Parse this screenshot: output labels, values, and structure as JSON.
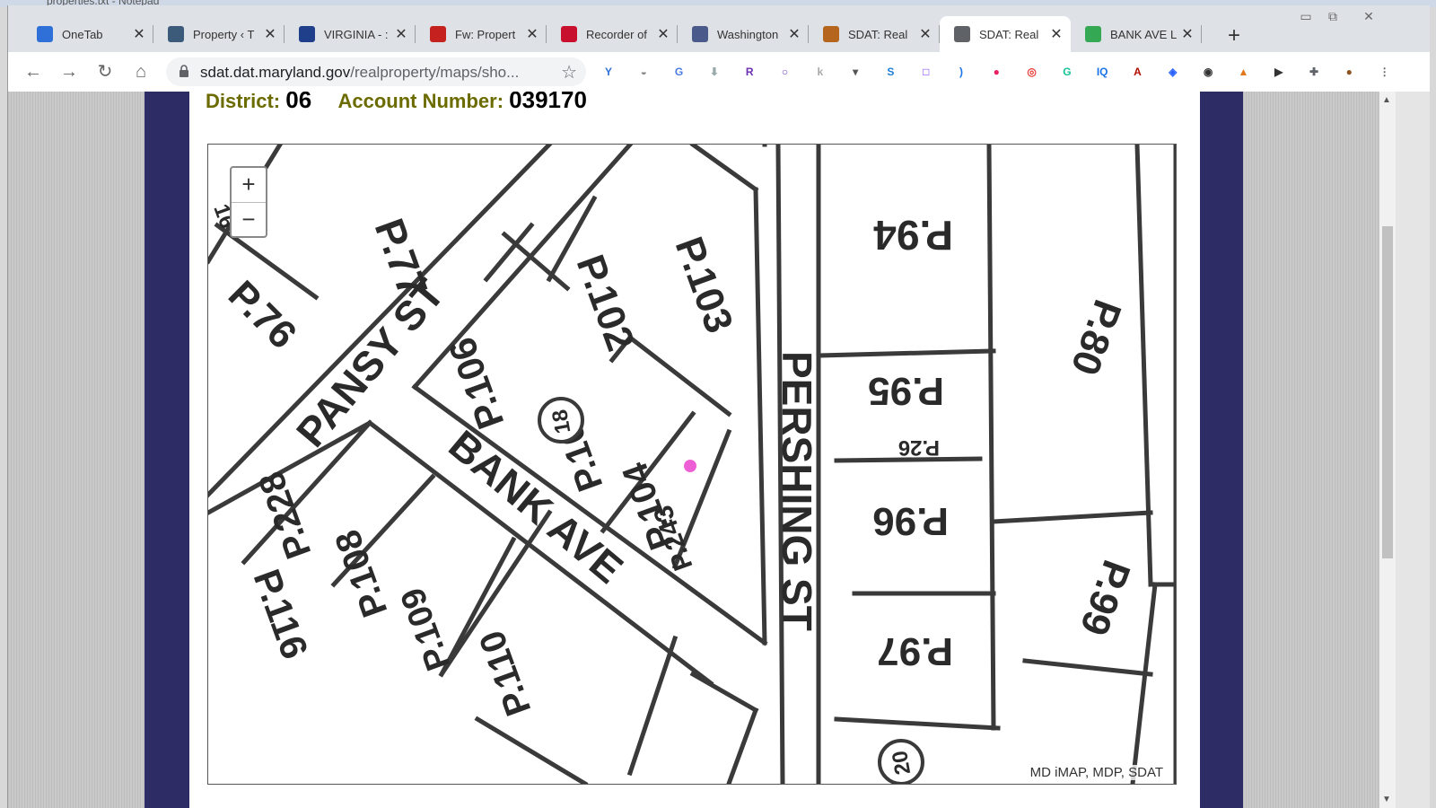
{
  "background_window": {
    "title": "properties.txt - Notepad"
  },
  "tabs": [
    {
      "label": "OneTab",
      "icon": "onetab-icon",
      "color": "#2f6fd8"
    },
    {
      "label": "Property ‹ T",
      "icon": "wordpress-icon",
      "color": "#3c5a7a"
    },
    {
      "label": "VIRGINIA - :",
      "icon": "scc-icon",
      "color": "#1f3f8a"
    },
    {
      "label": "Fw: Propert",
      "icon": "gmail-icon",
      "color": "#c5221f"
    },
    {
      "label": "Recorder of",
      "icon": "recorder-icon",
      "color": "#c8102e"
    },
    {
      "label": "Washington",
      "icon": "washington-icon",
      "color": "#4a5a8a"
    },
    {
      "label": "SDAT: Real",
      "icon": "maryland-flag-icon",
      "color": "#b5651d"
    },
    {
      "label": "SDAT: Real",
      "icon": "globe-icon",
      "color": "#5f6368",
      "active": true
    },
    {
      "label": "BANK AVE L",
      "icon": "google-maps-icon",
      "color": "#34a853"
    }
  ],
  "toolbar": {
    "url_host": "sdat.dat.maryland.gov",
    "url_path": "/realproperty/maps/sho..."
  },
  "page": {
    "district_label": "District:",
    "district_value": "06",
    "account_label": "Account Number:",
    "account_value": "039170"
  },
  "map": {
    "zoom_in": "+",
    "zoom_out": "−",
    "attribution": "MD iMAP, MDP, SDAT",
    "streets": [
      "PANSY ST",
      "BANK AVE",
      "PERSHING ST"
    ],
    "parcels": [
      "P.77",
      "P.102",
      "P.103",
      "P.76",
      "P.106",
      "P.105",
      "P.104",
      "P.243",
      "P.228",
      "P.108",
      "P.109",
      "P.116",
      "P.110",
      "P.94",
      "P.95",
      "P.26",
      "P.96",
      "P.97",
      "P.80",
      "P.99"
    ],
    "grid_markers": [
      "18",
      "20",
      "16"
    ]
  }
}
